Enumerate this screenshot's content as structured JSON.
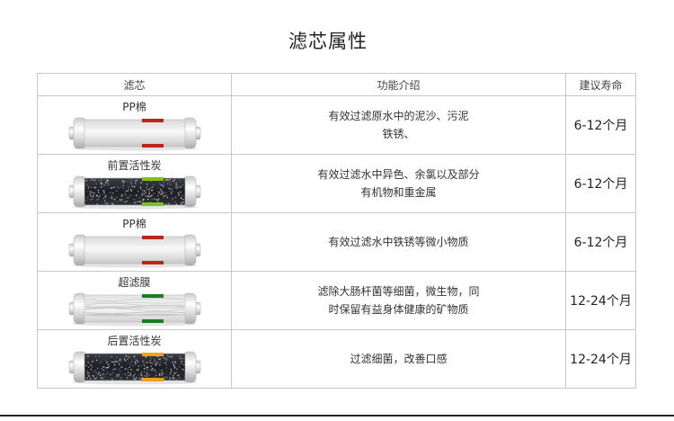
{
  "title": "滤芯属性",
  "table": {
    "headers": [
      "滤芯",
      "功能介绍",
      "建议寿命"
    ],
    "rows": [
      {
        "name": "PP棉",
        "function_lines": [
          "有效过滤原水中的泥沙、污泥",
          "铁锈、"
        ],
        "life": "6-12个月",
        "media": "pp",
        "band_color": "#b8261c"
      },
      {
        "name": "前置活性炭",
        "function_lines": [
          "有效过滤水中异色、余氯以及部分",
          "有机物和重金属"
        ],
        "life": "6-12个月",
        "media": "carbon",
        "band_color": "#7cc21a"
      },
      {
        "name": "PP棉",
        "function_lines": [
          "有效过滤水中铁锈等微小物质"
        ],
        "life": "6-12个月",
        "media": "pp",
        "band_color": "#b8261c"
      },
      {
        "name": "超滤膜",
        "function_lines": [
          "滤除大肠杆菌等细菌，微生物，同",
          "时保留有益身体健康的矿物质"
        ],
        "life": "12-24个月",
        "media": "membrane",
        "band_color": "#1f7a2a"
      },
      {
        "name": "后置活性炭",
        "function_lines": [
          "过滤细菌，改善口感"
        ],
        "life": "12-24个月",
        "media": "carbon",
        "band_color": "#f0a318"
      }
    ]
  }
}
